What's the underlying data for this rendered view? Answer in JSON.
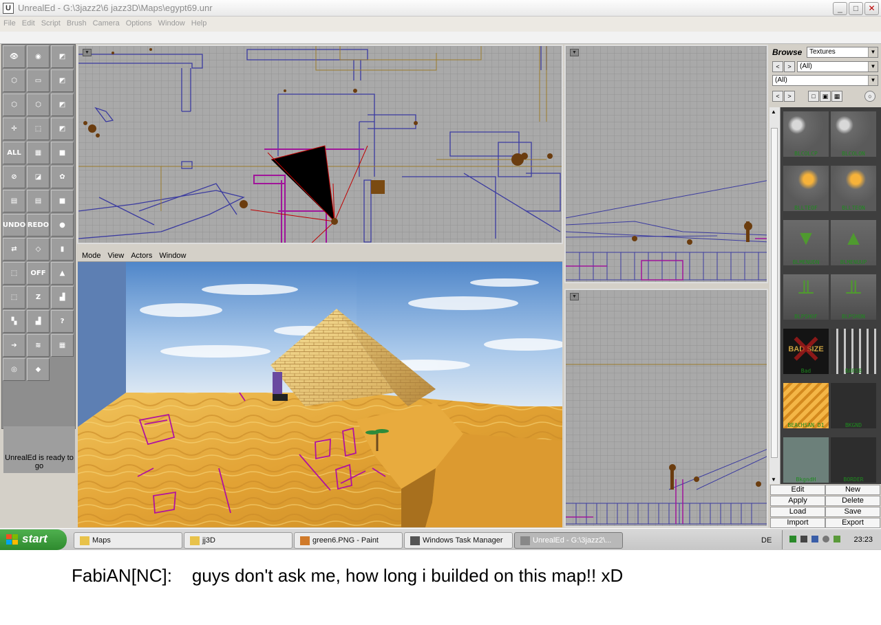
{
  "window": {
    "title": "UnrealEd - G:\\3jazz2\\6 jazz3D\\Maps\\egypt69.unr",
    "minimize": "_",
    "maximize": "□",
    "close": "✕"
  },
  "menu": [
    "File",
    "Edit",
    "Script",
    "Brush",
    "Camera",
    "Options",
    "Window",
    "Help"
  ],
  "toolbar": {
    "buttons": [
      {
        "name": "camera-move-icon",
        "glyph": "👁"
      },
      {
        "name": "camera-zoom-icon",
        "glyph": "◉"
      },
      {
        "name": "brush-clip-icon",
        "glyph": "◩"
      },
      {
        "name": "vertex-edit-icon",
        "glyph": "⬡"
      },
      {
        "name": "eraser-icon",
        "glyph": "▭"
      },
      {
        "name": "texture-pan-icon",
        "glyph": "◩"
      },
      {
        "name": "rotate-brush-icon",
        "glyph": "⬡"
      },
      {
        "name": "scale-brush-icon",
        "glyph": "⬡"
      },
      {
        "name": "texture-rotate-icon",
        "glyph": "◩"
      },
      {
        "name": "pivot-icon",
        "glyph": "✛"
      },
      {
        "name": "select-brush-icon",
        "glyph": "⬚"
      },
      {
        "name": "intersect-icon",
        "glyph": "◩"
      },
      {
        "name": "select-all-icon",
        "glyph": "ALL"
      },
      {
        "name": "texture-apply-icon",
        "glyph": "▦"
      },
      {
        "name": "green-square-icon",
        "glyph": "■"
      },
      {
        "name": "deselect-icon",
        "glyph": "⊘"
      },
      {
        "name": "zone-icon",
        "glyph": "◪"
      },
      {
        "name": "terrain-icon",
        "glyph": "✿"
      },
      {
        "name": "group-icon",
        "glyph": "▤"
      },
      {
        "name": "ungroup-icon",
        "glyph": "▤"
      },
      {
        "name": "cube-primitive-icon",
        "glyph": "■"
      },
      {
        "name": "undo-icon",
        "glyph": "UNDO"
      },
      {
        "name": "redo-icon",
        "glyph": "REDO"
      },
      {
        "name": "sphere-primitive-icon",
        "glyph": "●"
      },
      {
        "name": "mirror-icon",
        "glyph": "⇄"
      },
      {
        "name": "sheet-primitive-icon",
        "glyph": "◇"
      },
      {
        "name": "cylinder-primitive-icon",
        "glyph": "▮"
      },
      {
        "name": "snap-grid-icon",
        "glyph": "⬚"
      },
      {
        "name": "snap-off-icon",
        "glyph": "OFF"
      },
      {
        "name": "cone-primitive-icon",
        "glyph": "▲"
      },
      {
        "name": "box-select-icon",
        "glyph": "⬚"
      },
      {
        "name": "z-axis-icon",
        "glyph": "Z"
      },
      {
        "name": "stairs-primitive-icon",
        "glyph": "▟"
      },
      {
        "name": "staircase-icon",
        "glyph": "▚"
      },
      {
        "name": "spiral-stairs-icon",
        "glyph": "▟"
      },
      {
        "name": "lasso-icon",
        "glyph": "?"
      },
      {
        "name": "arrow-right-icon",
        "glyph": "➔"
      },
      {
        "name": "curved-stairs-icon",
        "glyph": "≋"
      },
      {
        "name": "grid-icon",
        "glyph": "▦"
      },
      {
        "name": "radar-icon",
        "glyph": "◎"
      },
      {
        "name": "flat-primitive-icon",
        "glyph": "◆"
      }
    ],
    "status_text": "UnrealEd is ready to go"
  },
  "viewport3d": {
    "menu": [
      "Mode",
      "View",
      "Actors",
      "Window"
    ]
  },
  "browser": {
    "label": "Browse",
    "type_selected": "Textures",
    "package_selected": "(All)",
    "group_selected": "(All)",
    "prev": "<",
    "next": ">",
    "textures": [
      {
        "label": "BLCOLCP",
        "kind": "balls"
      },
      {
        "label": "BLCOLON",
        "kind": "balls"
      },
      {
        "label": "BLLTEOF",
        "kind": "torch"
      },
      {
        "label": "BLLTEON",
        "kind": "torch"
      },
      {
        "label": "BLMENUDN",
        "kind": "arrow-down"
      },
      {
        "label": "BLMENUUP",
        "kind": "arrow-up"
      },
      {
        "label": "BLPSHOF",
        "kind": "lever"
      },
      {
        "label": "BLPSHON",
        "kind": "lever"
      },
      {
        "label": "Bad",
        "kind": "bad",
        "overlay": "BAD SIZE"
      },
      {
        "label": "BARSB",
        "kind": "bars"
      },
      {
        "label": "BEACHSAN D1",
        "kind": "sand"
      },
      {
        "label": "BKGND",
        "kind": "dark"
      },
      {
        "label": "BkgndH",
        "kind": "teal"
      },
      {
        "label": "BORDER",
        "kind": "dark"
      }
    ],
    "buttons": [
      {
        "name": "edit-button",
        "label": "Edit"
      },
      {
        "name": "new-button",
        "label": "New"
      },
      {
        "name": "apply-button",
        "label": "Apply"
      },
      {
        "name": "delete-button",
        "label": "Delete"
      },
      {
        "name": "load-button",
        "label": "Load"
      },
      {
        "name": "save-button",
        "label": "Save"
      },
      {
        "name": "import-button",
        "label": "Import"
      },
      {
        "name": "export-button",
        "label": "Export"
      }
    ]
  },
  "taskbar": {
    "start": "start",
    "tasks": [
      {
        "name": "task-maps",
        "label": "Maps",
        "icon": "folder-icon"
      },
      {
        "name": "task-jj3d",
        "label": "jj3D",
        "icon": "folder-icon"
      },
      {
        "name": "task-paint",
        "label": "green6.PNG - Paint",
        "icon": "paint-icon"
      },
      {
        "name": "task-taskmanager",
        "label": "Windows Task Manager",
        "icon": "taskmanager-icon"
      },
      {
        "name": "task-unrealed",
        "label": "UnrealEd - G:\\3jazz2\\...",
        "icon": "unrealed-icon"
      }
    ],
    "language": "DE",
    "clock": "23:23"
  },
  "caption": {
    "author": "FabiAN[NC]:",
    "text": "guys don't ask me, how long i builded on this map!! xD"
  },
  "colors": {
    "grid_bg": "#a9a9a9",
    "grid_line": "#8f8f8f",
    "brush_blue": "#3a3aa0",
    "brush_gold": "#9a7a2a",
    "selected_magenta": "#a0149a",
    "sky": "#7aaee0",
    "sand": "#e6a23c"
  }
}
